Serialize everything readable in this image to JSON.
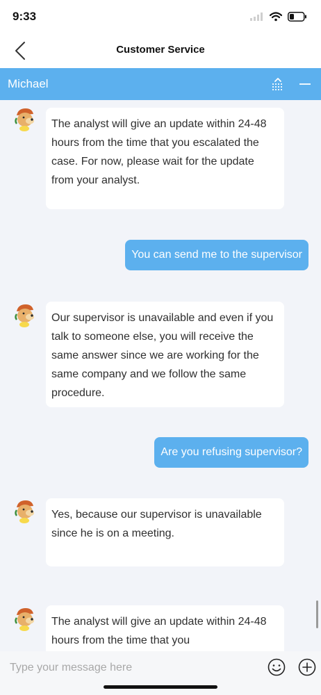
{
  "status_bar": {
    "time": "9:33"
  },
  "nav": {
    "title": "Customer Service"
  },
  "agent": {
    "name": "Michael"
  },
  "messages": [
    {
      "from": "agent",
      "text": "The analyst will give an update within 24-48 hours from the time that you escalated the case. For now, please wait for the update from your analyst."
    },
    {
      "from": "user",
      "text": "You can send me to the supervisor"
    },
    {
      "from": "agent",
      "text": "Our supervisor is unavailable and even if you talk to someone else, you will receive the same answer since we are working for the same company and we follow the same procedure."
    },
    {
      "from": "user",
      "text": "Are you refusing supervisor?"
    },
    {
      "from": "agent",
      "text": "Yes, because our supervisor is unavailable since he is on a meeting."
    },
    {
      "from": "agent",
      "text": "The analyst will give an update within 24-48 hours from the time that you"
    }
  ],
  "composer": {
    "placeholder": "Type your message here"
  },
  "colors": {
    "accent": "#5cb0ee",
    "background": "#f2f4f9"
  },
  "icons": [
    "wifi-icon",
    "battery-icon",
    "back-chevron-icon",
    "sort-icon",
    "minimize-icon",
    "emoji-icon",
    "plus-circle-icon"
  ]
}
